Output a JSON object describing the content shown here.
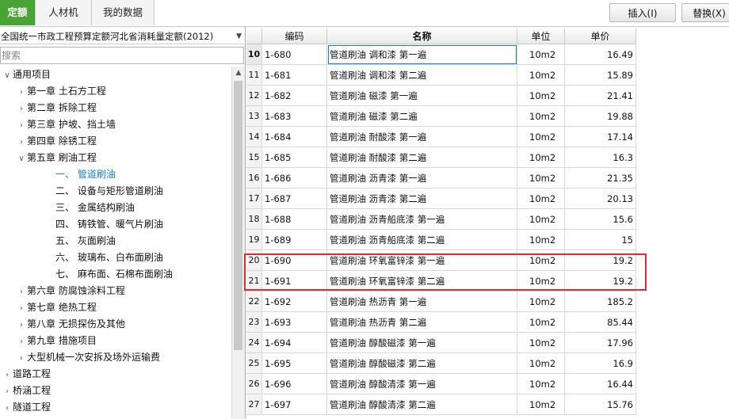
{
  "tabs": [
    {
      "label": "定额",
      "active": true
    },
    {
      "label": "人材机",
      "active": false
    },
    {
      "label": "我的数据",
      "active": false
    }
  ],
  "toolbar": {
    "insert_label": "插入(I)",
    "replace_label": "替换(X)"
  },
  "left": {
    "quota_library": "全国统一市政工程预算定额河北省消耗量定额(2012)",
    "search_placeholder": "搜索"
  },
  "tree": [
    {
      "level": 0,
      "caret": "down",
      "label": "通用项目"
    },
    {
      "level": 1,
      "caret": "right",
      "label": "第一章 土石方工程"
    },
    {
      "level": 1,
      "caret": "right",
      "label": "第二章 拆除工程"
    },
    {
      "level": 1,
      "caret": "right",
      "label": "第三章 护坡、挡土墙"
    },
    {
      "level": 1,
      "caret": "right",
      "label": "第四章 除锈工程"
    },
    {
      "level": 1,
      "caret": "down",
      "label": "第五章 刷油工程"
    },
    {
      "level": 2,
      "caret": "",
      "label": "一、 管道刷油",
      "selected": true
    },
    {
      "level": 2,
      "caret": "",
      "label": "二、 设备与矩形管道刷油"
    },
    {
      "level": 2,
      "caret": "",
      "label": "三、 金属结构刷油"
    },
    {
      "level": 2,
      "caret": "",
      "label": "四、 铸铁管、暖气片刷油"
    },
    {
      "level": 2,
      "caret": "",
      "label": "五、 灰面刷油"
    },
    {
      "level": 2,
      "caret": "",
      "label": "六、 玻璃布、白布面刷油"
    },
    {
      "level": 2,
      "caret": "",
      "label": "七、 麻布面、石棉布面刷油"
    },
    {
      "level": 1,
      "caret": "right",
      "label": "第六章 防腐蚀涂料工程"
    },
    {
      "level": 1,
      "caret": "right",
      "label": "第七章 绝热工程"
    },
    {
      "level": 1,
      "caret": "right",
      "label": "第八章 无损探伤及其他"
    },
    {
      "level": 1,
      "caret": "right",
      "label": "第九章 措施项目"
    },
    {
      "level": 1,
      "caret": "right",
      "label": "大型机械一次安拆及场外运输费"
    },
    {
      "level": 0,
      "caret": "right",
      "label": "道路工程"
    },
    {
      "level": 0,
      "caret": "right",
      "label": "桥涵工程"
    },
    {
      "level": 0,
      "caret": "right",
      "label": "隧道工程"
    }
  ],
  "grid": {
    "headers": {
      "code": "编码",
      "name": "名称",
      "unit": "单位",
      "price": "单价"
    },
    "rows": [
      {
        "idx": "10",
        "code": "1-680",
        "name": "管道刷油 调和漆 第一遍",
        "unit": "10m2",
        "price": "16.49",
        "selected": true
      },
      {
        "idx": "11",
        "code": "1-681",
        "name": "管道刷油 调和漆 第二遍",
        "unit": "10m2",
        "price": "15.89"
      },
      {
        "idx": "12",
        "code": "1-682",
        "name": "管道刷油 磁漆 第一遍",
        "unit": "10m2",
        "price": "21.41"
      },
      {
        "idx": "13",
        "code": "1-683",
        "name": "管道刷油 磁漆 第二遍",
        "unit": "10m2",
        "price": "19.88"
      },
      {
        "idx": "14",
        "code": "1-684",
        "name": "管道刷油 耐酸漆 第一遍",
        "unit": "10m2",
        "price": "17.14"
      },
      {
        "idx": "15",
        "code": "1-685",
        "name": "管道刷油 耐酸漆 第二遍",
        "unit": "10m2",
        "price": "16.3"
      },
      {
        "idx": "16",
        "code": "1-686",
        "name": "管道刷油 沥青漆 第一遍",
        "unit": "10m2",
        "price": "21.35"
      },
      {
        "idx": "17",
        "code": "1-687",
        "name": "管道刷油 沥青漆 第二遍",
        "unit": "10m2",
        "price": "20.13"
      },
      {
        "idx": "18",
        "code": "1-688",
        "name": "管道刷油 沥青船底漆 第一遍",
        "unit": "10m2",
        "price": "15.6"
      },
      {
        "idx": "19",
        "code": "1-689",
        "name": "管道刷油 沥青船底漆 第二遍",
        "unit": "10m2",
        "price": "15"
      },
      {
        "idx": "20",
        "code": "1-690",
        "name": "管道刷油 环氧富锌漆 第一遍",
        "unit": "10m2",
        "price": "19.2"
      },
      {
        "idx": "21",
        "code": "1-691",
        "name": "管道刷油 环氧富锌漆 第二遍",
        "unit": "10m2",
        "price": "19.2"
      },
      {
        "idx": "22",
        "code": "1-692",
        "name": "管道刷油 热沥青 第一遍",
        "unit": "10m2",
        "price": "185.2"
      },
      {
        "idx": "23",
        "code": "1-693",
        "name": "管道刷油 热沥青 第二遍",
        "unit": "10m2",
        "price": "85.44"
      },
      {
        "idx": "24",
        "code": "1-694",
        "name": "管道刷油 醇酸磁漆 第一遍",
        "unit": "10m2",
        "price": "17.96"
      },
      {
        "idx": "25",
        "code": "1-695",
        "name": "管道刷油 醇酸磁漆 第二遍",
        "unit": "10m2",
        "price": "16.9"
      },
      {
        "idx": "26",
        "code": "1-696",
        "name": "管道刷油 醇酸清漆 第一遍",
        "unit": "10m2",
        "price": "16.44"
      },
      {
        "idx": "27",
        "code": "1-697",
        "name": "管道刷油 醇酸清漆 第二遍",
        "unit": "10m2",
        "price": "15.76"
      }
    ]
  },
  "colors": {
    "active_tab": "#4aa335",
    "highlight_box": "#e22a33",
    "selected_tree_text": "#1a7fd4"
  }
}
